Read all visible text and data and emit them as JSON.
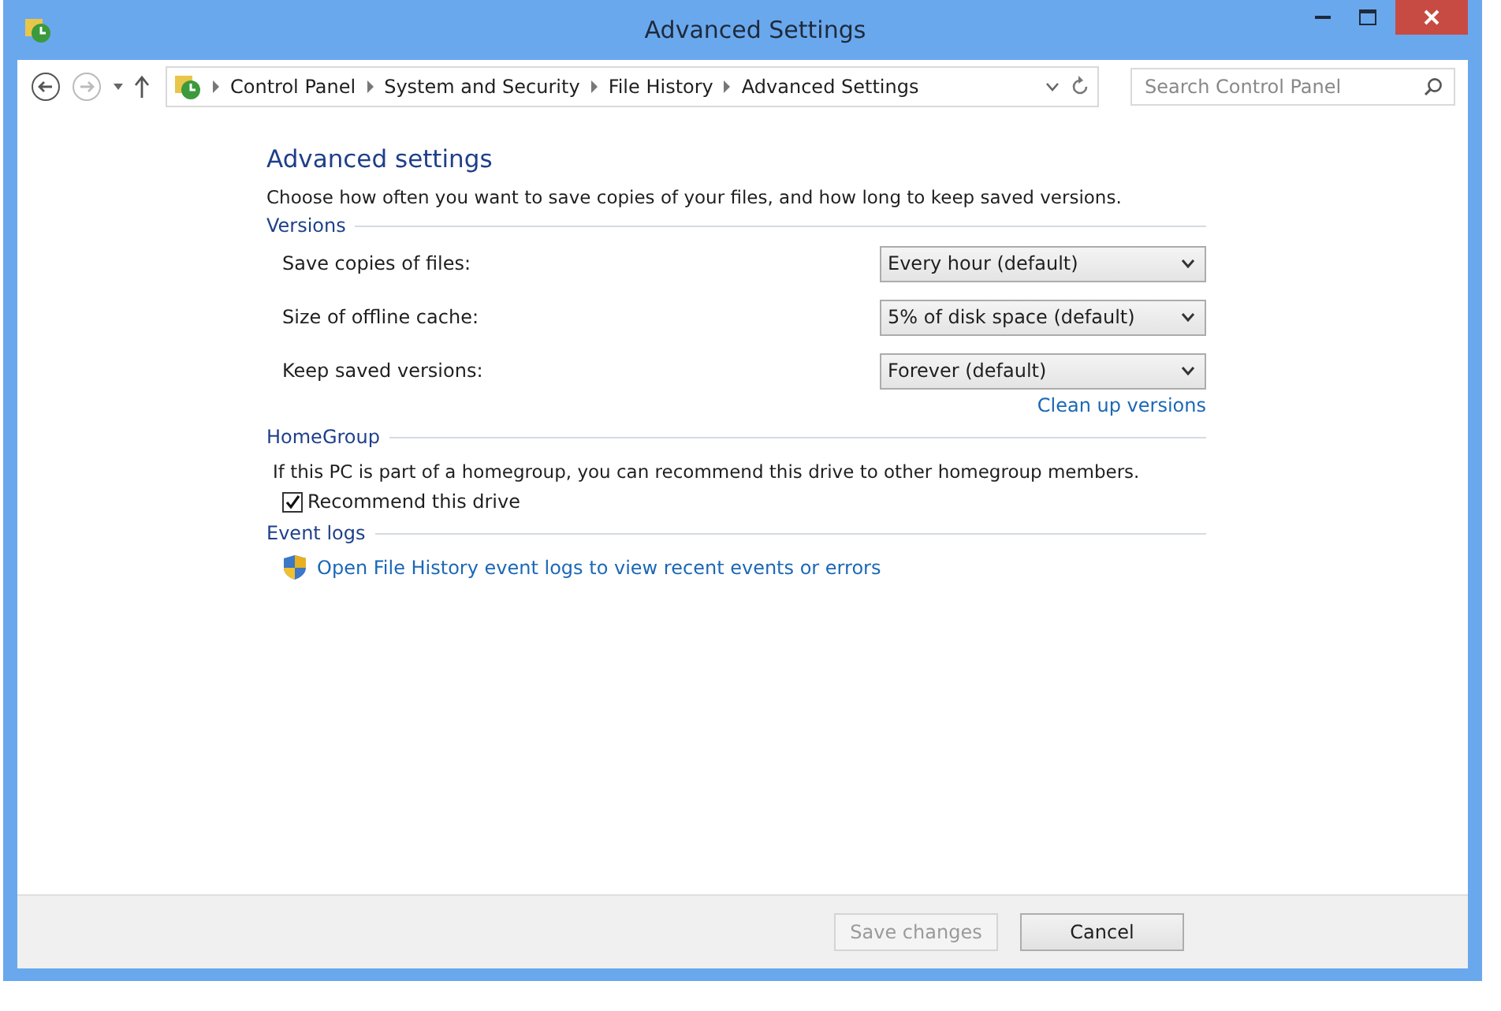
{
  "window": {
    "title": "Advanced Settings"
  },
  "address_bar": {
    "breadcrumbs": [
      "Control Panel",
      "System and Security",
      "File History",
      "Advanced Settings"
    ]
  },
  "search": {
    "placeholder": "Search Control Panel"
  },
  "heading": "Advanced settings",
  "description": "Choose how often you want to save copies of your files, and how long to keep saved versions.",
  "versions": {
    "title": "Versions",
    "settings": [
      {
        "label": "Save copies of files:",
        "value": "Every hour (default)"
      },
      {
        "label": "Size of offline cache:",
        "value": "5% of disk space (default)"
      },
      {
        "label": "Keep saved versions:",
        "value": "Forever (default)"
      }
    ],
    "link": "Clean up versions"
  },
  "homegroup": {
    "title": "HomeGroup",
    "text": "If this PC is part of a homegroup, you can recommend this drive to other homegroup members.",
    "checkbox": {
      "label": "Recommend this drive",
      "checked": true
    }
  },
  "event_logs": {
    "title": "Event logs",
    "link": "Open File History event logs to view recent events or errors"
  },
  "buttons": [
    {
      "label": "Save changes",
      "disabled": true
    },
    {
      "label": "Cancel",
      "disabled": false
    }
  ]
}
